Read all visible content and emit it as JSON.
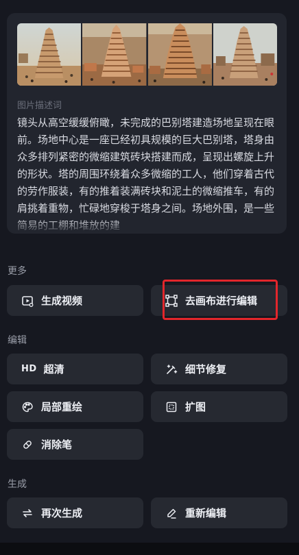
{
  "description": {
    "label": "图片描述词",
    "text": "镜头从高空缓缓俯瞰，未完成的巴别塔建造场地呈现在眼前。场地中心是一座已经初具规模的巨大巴别塔，塔身由众多排列紧密的微缩建筑砖块搭建而成，呈现出螺旋上升的形状。塔的周围环绕着众多微缩的工人，他们穿着古代的劳作服装，有的推着装满砖块和泥土的微缩推车，有的肩挑着重物，忙碌地穿梭于塔身之间。场地外围，是一些简易的工棚和堆放的建"
  },
  "thumbnails": [
    {
      "icon": "tower-image-1"
    },
    {
      "icon": "tower-image-2"
    },
    {
      "icon": "tower-image-3"
    },
    {
      "icon": "tower-image-4"
    }
  ],
  "sections": {
    "more": "更多",
    "edit": "编辑",
    "generate": "生成"
  },
  "buttons": {
    "generate_video": "生成视频",
    "canvas_edit": "去画布进行编辑",
    "hd_prefix": "HD",
    "super_res": "超清",
    "detail_repair": "细节修复",
    "local_redraw": "局部重绘",
    "expand": "扩图",
    "eraser": "消除笔",
    "regenerate": "再次生成",
    "re_edit": "重新编辑"
  },
  "colors": {
    "background": "#161820",
    "card": "#22252e",
    "button": "#262931",
    "highlight": "#e3262b"
  }
}
